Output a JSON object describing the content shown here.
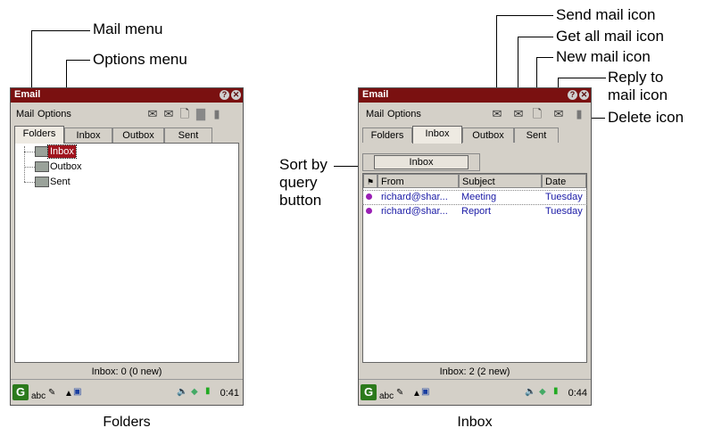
{
  "callouts": {
    "mail_menu": "Mail menu",
    "options_menu": "Options menu",
    "send_mail_icon": "Send mail icon",
    "get_all_mail_icon": "Get all mail icon",
    "new_mail_icon": "New mail icon",
    "reply_line1": "Reply to",
    "reply_line2": "mail icon",
    "delete_icon": "Delete icon",
    "sort_line1": "Sort by",
    "sort_line2": "query",
    "sort_line3": "button"
  },
  "captions": {
    "left": "Folders",
    "right": "Inbox"
  },
  "folders_screen": {
    "title": "Email",
    "help_btn": "?",
    "close_btn": "✕",
    "menus": [
      "Mail",
      "Options"
    ],
    "tabs": [
      "Folders",
      "Inbox",
      "Outbox",
      "Sent"
    ],
    "tree": [
      "Inbox",
      "Outbox",
      "Sent"
    ],
    "status": "Inbox: 0 (0 new)",
    "taskbar": {
      "app_icon": "G",
      "input_label": "abc",
      "clock": "0:41"
    }
  },
  "inbox_screen": {
    "title": "Email",
    "help_btn": "?",
    "close_btn": "✕",
    "menus": [
      "Mail",
      "Options"
    ],
    "tabs": [
      "Folders",
      "Inbox",
      "Outbox",
      "Sent"
    ],
    "query_button": "Inbox",
    "columns": {
      "flag": "⚑",
      "from": "From",
      "subject": "Subject",
      "date": "Date"
    },
    "rows": [
      {
        "from": "richard@shar...",
        "subject": "Meeting",
        "date": "Tuesday"
      },
      {
        "from": "richard@shar...",
        "subject": "Report",
        "date": "Tuesday"
      }
    ],
    "status": "Inbox: 2 (2 new)",
    "taskbar": {
      "app_icon": "G",
      "input_label": "abc",
      "clock": "0:44"
    }
  },
  "icons": [
    "send-mail-icon",
    "get-all-mail-icon",
    "new-mail-icon",
    "reply-mail-icon",
    "delete-icon",
    "flag-icon",
    "folder-icon",
    "unread-dot-icon"
  ]
}
